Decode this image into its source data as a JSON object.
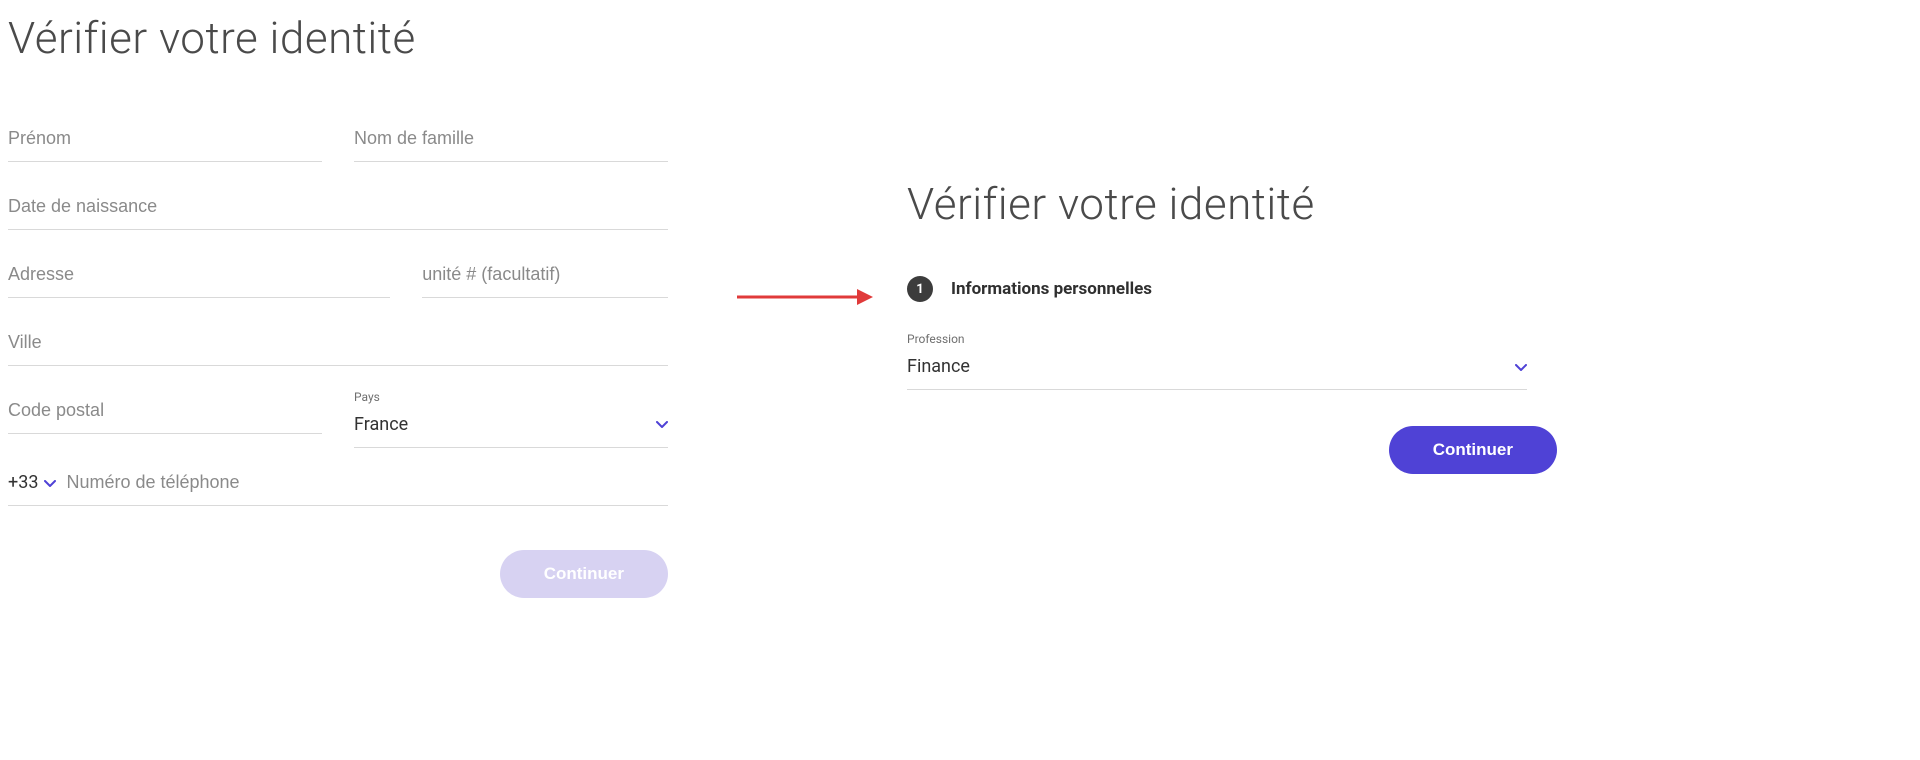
{
  "left": {
    "title": "Vérifier votre identité",
    "first_name_ph": "Prénom",
    "last_name_ph": "Nom de famille",
    "dob_ph": "Date de naissance",
    "address_ph": "Adresse",
    "unit_ph": "unité # (facultatif)",
    "city_ph": "Ville",
    "postal_ph": "Code postal",
    "country_label": "Pays",
    "country_value": "France",
    "cc_value": "+33",
    "phone_ph": "Numéro de téléphone",
    "continue_label": "Continuer"
  },
  "right": {
    "title": "Vérifier votre identité",
    "step_number": "1",
    "step_label": "Informations personnelles",
    "profession_label": "Profession",
    "profession_value": "Finance",
    "continue_label": "Continuer"
  }
}
